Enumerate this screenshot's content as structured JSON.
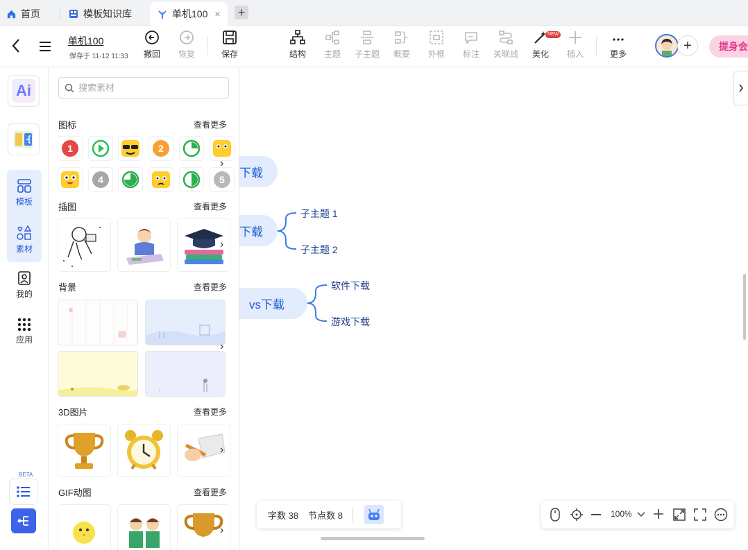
{
  "tabs": [
    {
      "label": "首页",
      "icon": "home-icon"
    },
    {
      "label": "模板知识库",
      "icon": "template-library-icon"
    },
    {
      "label": "单机100",
      "icon": "mindmap-icon",
      "close": "×"
    }
  ],
  "new_tab": "+",
  "doc": {
    "title": "单机100",
    "saved": "保存于 11-12 11:33"
  },
  "toolbar": {
    "undo": "撤回",
    "redo": "恢复",
    "save": "保存",
    "structure": "结构",
    "topic": "主题",
    "subtopic": "子主题",
    "summary": "概要",
    "frame": "外框",
    "label": "标注",
    "relation": "关联线",
    "beautify": "美化",
    "insert": "插入",
    "more": "更多",
    "new_badge": "NEW",
    "ad": "提身会"
  },
  "rail": {
    "ai": "Ai",
    "template": "模板",
    "material": "素材",
    "mine": "我的",
    "apps": "应用",
    "beta": "BETA"
  },
  "panel": {
    "search_placeholder": "搜索素材",
    "more": "查看更多",
    "sections": [
      "图标",
      "插图",
      "背景",
      "3D图片",
      "GIF动图"
    ],
    "icon_numbers": [
      "1",
      "2",
      "4",
      "5"
    ]
  },
  "canvas": {
    "nodes": [
      "下载",
      "下载",
      "vs下载"
    ],
    "subs": [
      "子主题 1",
      "子主题 2",
      "软件下载",
      "游戏下载"
    ]
  },
  "status": {
    "words": "字数 38",
    "nodes": "节点数 8",
    "zoom": "100%"
  },
  "colors": {
    "accent": "#1f5bd6",
    "node_bg": "#e3ecfc",
    "line": "#3d7be5"
  }
}
